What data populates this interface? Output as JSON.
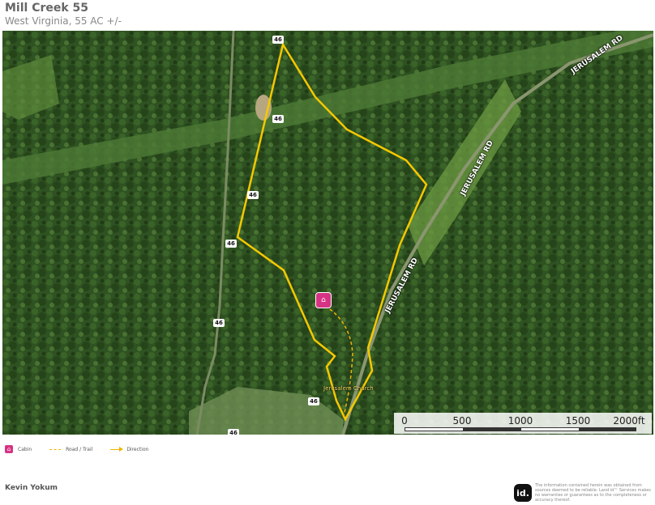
{
  "header": {
    "title": "Mill Creek 55",
    "subtitle": "West Virginia, 55 AC +/-"
  },
  "map": {
    "road_badges": [
      "46",
      "46",
      "46",
      "46",
      "46",
      "46",
      "46"
    ],
    "road_labels": [
      "JERUSALEM RD",
      "JERUSALEM RD",
      "JERUSALEM RD"
    ],
    "church_label": "Jerusalem Church",
    "colors": {
      "boundary": "#f5c800",
      "trail": "#f0b400",
      "cabin": "#d63384"
    }
  },
  "scale": {
    "labels": [
      "0",
      "500",
      "1000",
      "1500",
      "2000ft"
    ]
  },
  "legend": {
    "cabin": "Cabin",
    "road_trail": "Road / Trail",
    "direction": "Direction"
  },
  "footer": {
    "agent": "Kevin Yokum",
    "logo": "id.",
    "disclaimer": "The information contained herein was obtained from sources deemed to be reliable. Land id™ Services makes no warranties or guarantees as to the completeness or accuracy thereof."
  }
}
